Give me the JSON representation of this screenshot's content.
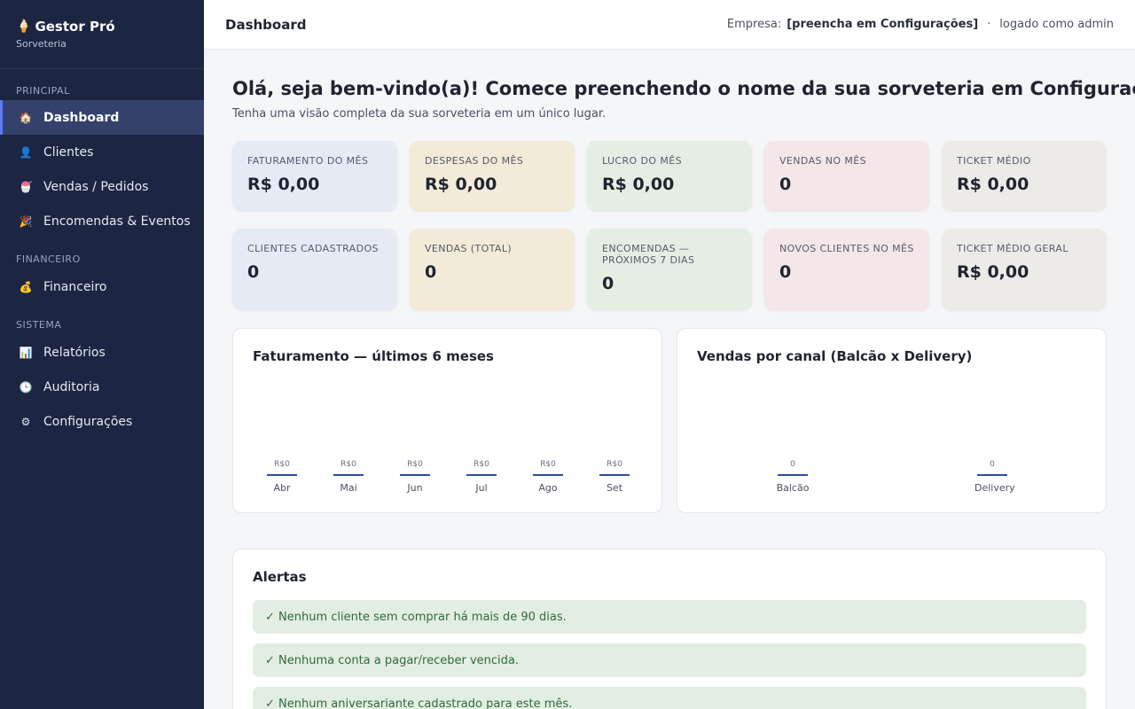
{
  "brand": {
    "icon": "ice-cream-icon",
    "title": "Gestor Pró",
    "subtitle": "Sorveteria"
  },
  "sidebar": {
    "sections": [
      {
        "label": "PRINCIPAL"
      },
      {
        "label": "FINANCEIRO"
      },
      {
        "label": "SISTEMA"
      }
    ],
    "items": [
      {
        "label": "Dashboard",
        "icon": "home-icon",
        "active": true
      },
      {
        "label": "Clientes",
        "icon": "user-icon"
      },
      {
        "label": "Vendas / Pedidos",
        "icon": "sundae-icon"
      },
      {
        "label": "Encomendas & Eventos",
        "icon": "party-icon"
      },
      {
        "label": "Financeiro",
        "icon": "money-bag-icon"
      },
      {
        "label": "Relatórios",
        "icon": "chart-icon"
      },
      {
        "label": "Auditoria",
        "icon": "clock-icon"
      },
      {
        "label": "Configurações",
        "icon": "gear-icon"
      }
    ]
  },
  "header": {
    "title": "Dashboard",
    "company_label": "Empresa:",
    "company_value": "[preencha em Configurações]",
    "separator": "·",
    "user_text": "logado como admin"
  },
  "welcome": {
    "title": "Olá, seja bem-vindo(a)! Comece preenchendo o nome da sua sorveteria em Configurações.",
    "subtitle": "Tenha uma visão completa da sua sorveteria em um único lugar."
  },
  "cards": [
    {
      "label": "FATURAMENTO DO MÊS",
      "value": "R$ 0,00"
    },
    {
      "label": "DESPESAS DO MÊS",
      "value": "R$ 0,00"
    },
    {
      "label": "LUCRO DO MÊS",
      "value": "R$ 0,00"
    },
    {
      "label": "VENDAS NO MÊS",
      "value": "0"
    },
    {
      "label": "TICKET MÉDIO",
      "value": "R$ 0,00"
    },
    {
      "label": "CLIENTES CADASTRADOS",
      "value": "0"
    },
    {
      "label": "VENDAS (TOTAL)",
      "value": "0"
    },
    {
      "label": "ENCOMENDAS — PRÓXIMOS 7 DIAS",
      "value": "0"
    },
    {
      "label": "NOVOS CLIENTES NO MÊS",
      "value": "0"
    },
    {
      "label": "TICKET MÉDIO GERAL",
      "value": "R$ 0,00"
    }
  ],
  "charts": {
    "revenue_title": "Faturamento — últimos 6 meses",
    "channel_title": "Vendas por canal (Balcão x Delivery)"
  },
  "chart_data": [
    {
      "type": "bar",
      "categories": [
        "Abr",
        "Mai",
        "Jun",
        "Jul",
        "Ago",
        "Set"
      ],
      "values": [
        0,
        0,
        0,
        0,
        0,
        0
      ],
      "value_labels": [
        "R$0",
        "R$0",
        "R$0",
        "R$0",
        "R$0",
        "R$0"
      ],
      "title": "Faturamento — últimos 6 meses"
    },
    {
      "type": "bar",
      "categories": [
        "Balcão",
        "Delivery"
      ],
      "values": [
        0,
        0
      ],
      "value_labels": [
        "0",
        "0"
      ],
      "title": "Vendas por canal (Balcão x Delivery)"
    }
  ],
  "alerts": {
    "title": "Alertas",
    "items": [
      "✓ Nenhum cliente sem comprar há mais de 90 dias.",
      "✓ Nenhuma conta a pagar/receber vencida.",
      "✓ Nenhum aniversariante cadastrado para este mês."
    ]
  },
  "colors": {
    "sidebar_bg": "#1c2541",
    "accent": "#5b7cff",
    "bar": "#2b4fa3",
    "alert_bg": "#e3eee2",
    "alert_text": "#2e6b3a"
  }
}
